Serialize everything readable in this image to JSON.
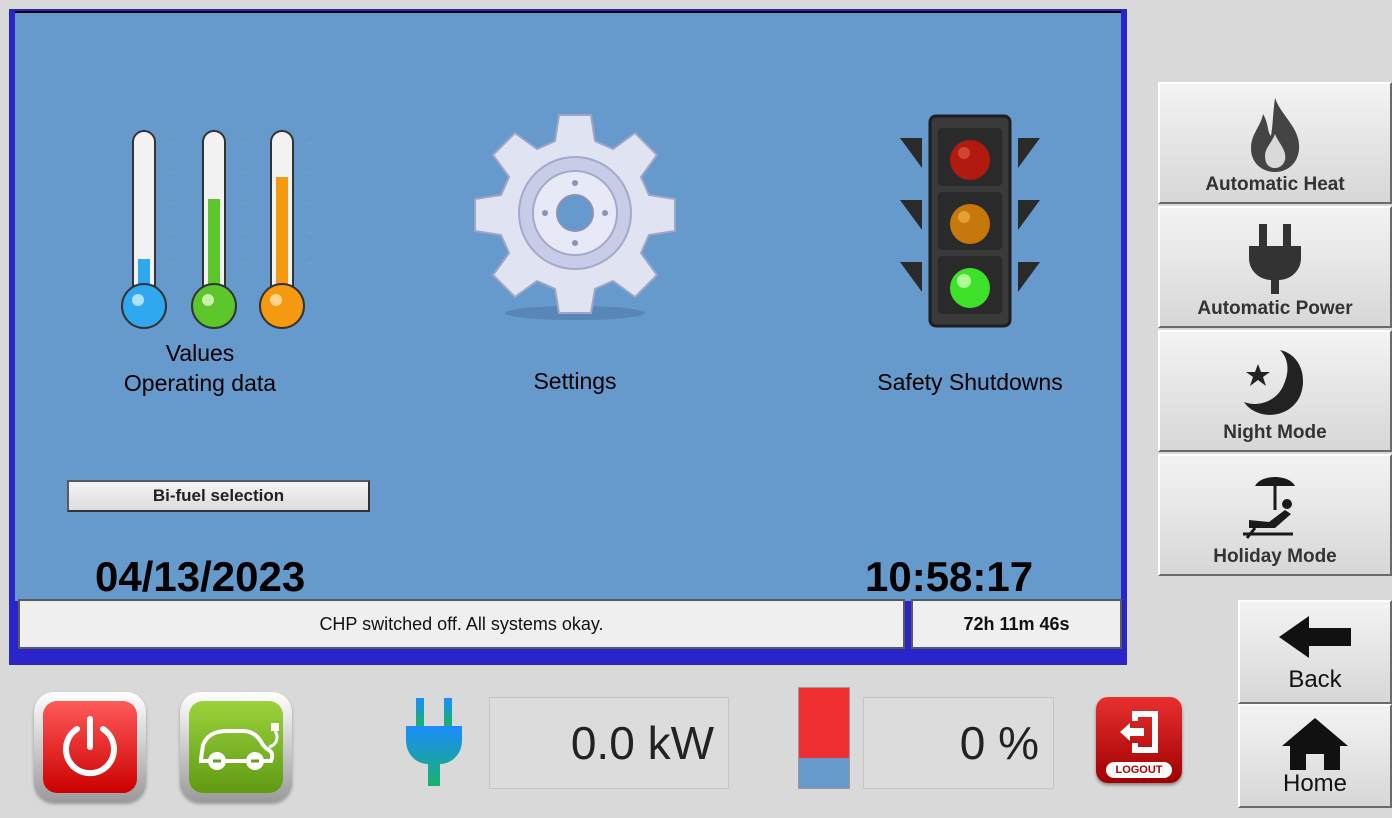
{
  "tiles": {
    "values_line1": "Values",
    "values_line2": "Operating data",
    "settings": "Settings",
    "safety": "Safety Shutdowns"
  },
  "bifuel_button": "Bi-fuel selection",
  "date": "04/13/2023",
  "time": "10:58:17",
  "status_message": "CHP switched off. All systems okay.",
  "runtime": "72h 11m 46s",
  "modes": {
    "automatic_heat": "Automatic Heat",
    "automatic_power": "Automatic Power",
    "night_mode": "Night Mode",
    "holiday_mode": "Holiday Mode"
  },
  "nav": {
    "back": "Back",
    "home": "Home"
  },
  "power_readout": "0.0 kW",
  "percent_readout": "0 %",
  "level_bar_red_fraction": 0.7,
  "logout_label": "LOGOUT",
  "thermometer_levels": [
    0.25,
    0.62,
    0.74
  ],
  "colors": {
    "panel_background": "#6699cc",
    "panel_border": "#2a25c8",
    "thermo_blue": "#2fa8f0",
    "thermo_green": "#5cc62a",
    "thermo_orange": "#f59a10"
  },
  "icons": [
    "flame-icon",
    "plug-icon",
    "moon-star-icon",
    "beach-chair-icon",
    "back-arrow-icon",
    "home-icon",
    "power-icon",
    "electric-car-icon",
    "logout-icon",
    "gear-icon",
    "traffic-light-icon",
    "thermometer-icon"
  ]
}
